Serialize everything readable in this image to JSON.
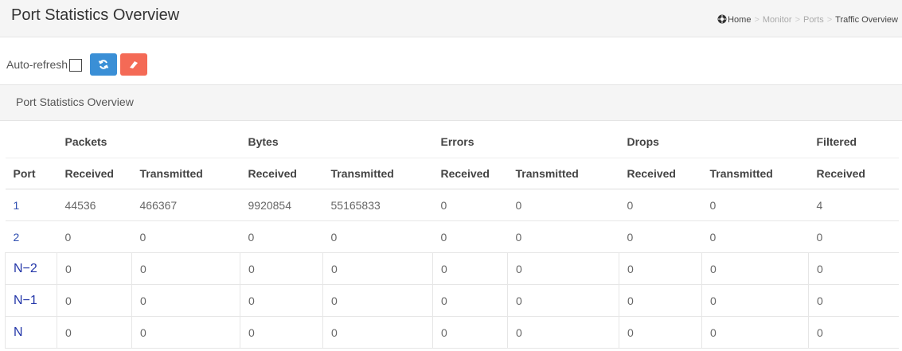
{
  "header": {
    "title": "Port Statistics Overview",
    "breadcrumb": [
      "Home",
      "Monitor",
      "Ports",
      "Traffic Overview"
    ],
    "breadcrumb_sep": ">"
  },
  "controls": {
    "auto_refresh_label": "Auto-refresh",
    "auto_refresh_checked": false,
    "refresh_icon": "refresh-icon",
    "clear_icon": "eraser-icon",
    "refresh_color": "#3a8fd6",
    "clear_color": "#f46a56"
  },
  "panel": {
    "title": "Port Statistics Overview"
  },
  "table": {
    "port_header": "Port",
    "groups": [
      "Packets",
      "Bytes",
      "Errors",
      "Drops",
      "Filtered"
    ],
    "sub_headers": [
      "Received",
      "Transmitted",
      "Received",
      "Transmitted",
      "Received",
      "Transmitted",
      "Received",
      "Transmitted",
      "Received"
    ],
    "rows": [
      {
        "port": "1",
        "values": [
          "44536",
          "466367",
          "9920854",
          "55165833",
          "0",
          "0",
          "0",
          "0",
          "4"
        ]
      },
      {
        "port": "2",
        "values": [
          "0",
          "0",
          "0",
          "0",
          "0",
          "0",
          "0",
          "0",
          "0"
        ]
      },
      {
        "port": "N−2",
        "values": [
          "0",
          "0",
          "0",
          "0",
          "0",
          "0",
          "0",
          "0",
          "0"
        ]
      },
      {
        "port": "N−1",
        "values": [
          "0",
          "0",
          "0",
          "0",
          "0",
          "0",
          "0",
          "0",
          "0"
        ]
      },
      {
        "port": "N",
        "values": [
          "0",
          "0",
          "0",
          "0",
          "0",
          "0",
          "0",
          "0",
          "0"
        ]
      }
    ]
  },
  "colors": {
    "link": "#2f4fb0",
    "header_bg": "#f5f5f5"
  }
}
